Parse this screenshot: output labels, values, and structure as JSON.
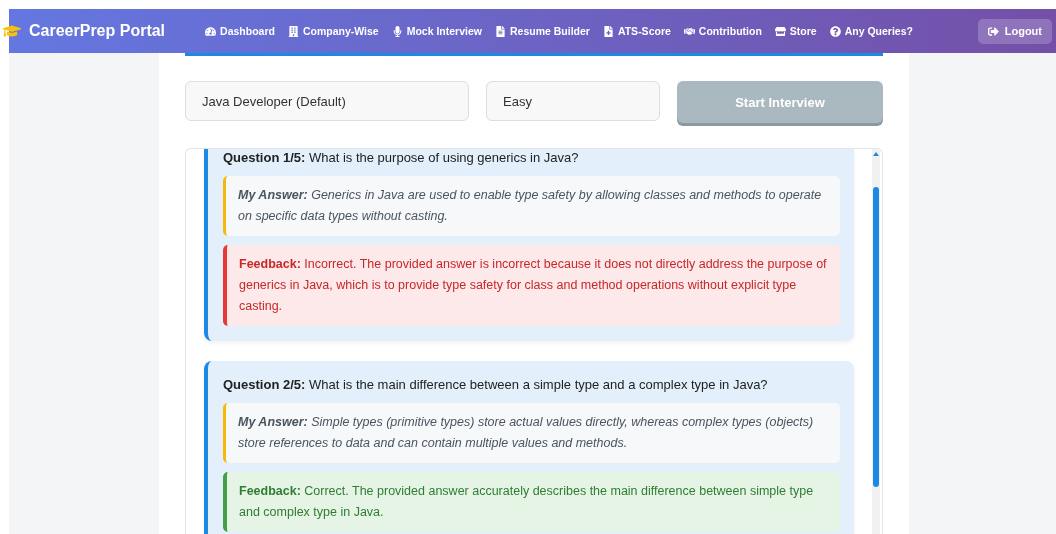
{
  "nav": {
    "brand": "CareerPrep Portal",
    "items": [
      "Dashboard",
      "Company-Wise",
      "Mock Interview",
      "Resume Builder",
      "ATS-Score",
      "Contribution",
      "Store",
      "Any Queries?"
    ],
    "logout": "Logout"
  },
  "controls": {
    "role": "Java Developer (Default)",
    "difficulty": "Easy",
    "start_button": {
      "label": "Start Interview",
      "disabled": true
    }
  },
  "questions": [
    {
      "question": "**Question 1/5:** What is the purpose of using generics in Java?",
      "answer": "**My Answer:** Generics in Java are used to enable type safety by allowing classes and methods to operate on specific data types without casting.",
      "feedback": "**Feedback:** Incorrect. The provided answer is incorrect because it does not directly address the purpose of generics in Java, which is to provide type safety for class and method operations without explicit type casting.",
      "correct": false
    },
    {
      "question": "**Question 2/5:** What is the main difference between a simple type and a complex type in Java?",
      "answer": "**My Answer:** Simple types (primitive types) store actual values directly, whereas complex types (objects) store references to data and can contain multiple values and methods.",
      "feedback": "**Feedback:** Correct. The provided answer accurately describes the main difference between simple type and complex type in Java.",
      "correct": true
    }
  ]
}
